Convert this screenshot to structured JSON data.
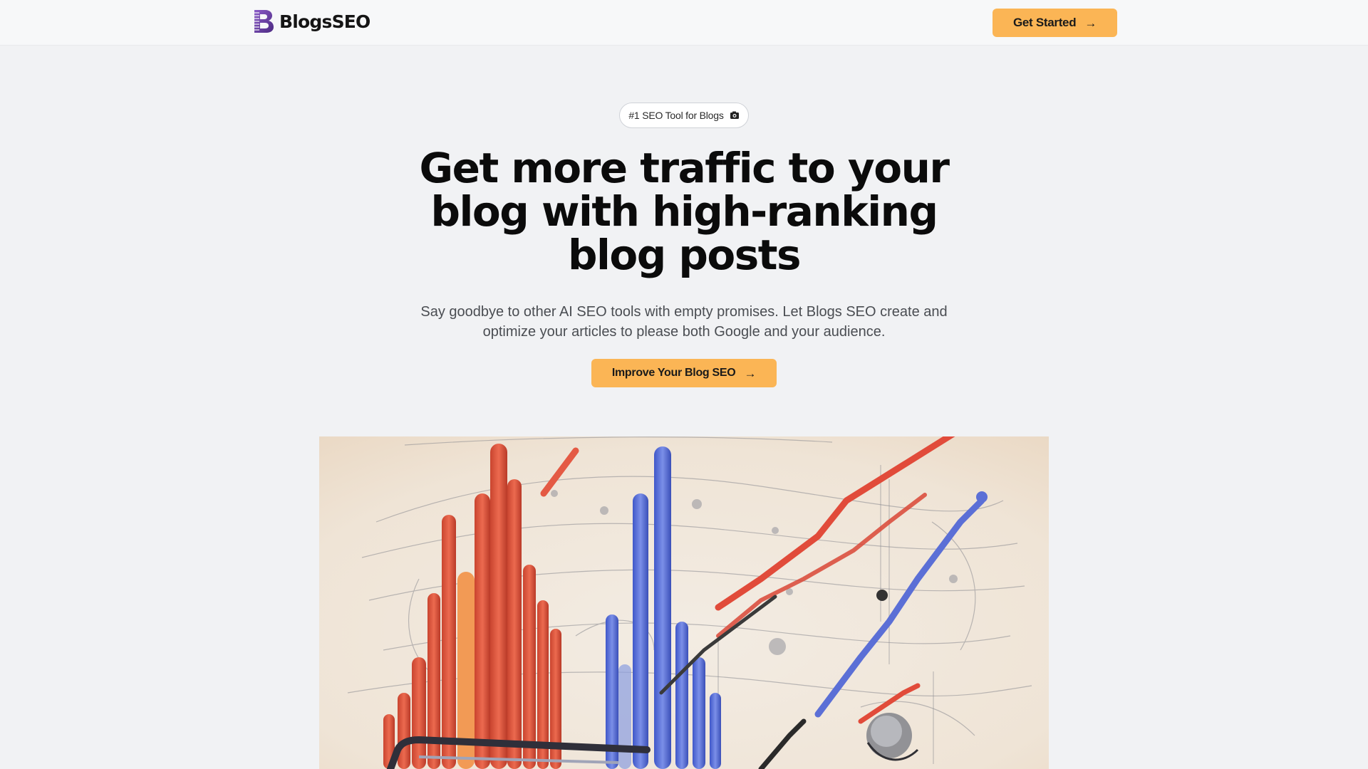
{
  "brand": {
    "name": "BlogsSEO",
    "accent_color": "#fbb555",
    "logo_color": "#6b3fa0"
  },
  "nav": {
    "cta_label": "Get Started",
    "cta_icon": "arrow-right-icon"
  },
  "hero": {
    "badge_text": "#1 SEO Tool for Blogs",
    "badge_icon": "camera-icon",
    "headline": "Get more traffic to your blog with high-ranking blog posts",
    "subheadline": "Say goodbye to other AI SEO tools with empty promises. Let Blogs SEO create and optimize your articles to please both Google and your audience.",
    "cta_label": "Improve Your Blog SEO",
    "cta_icon": "arrow-right-icon",
    "image_subject": "growth-chart-illustration"
  }
}
